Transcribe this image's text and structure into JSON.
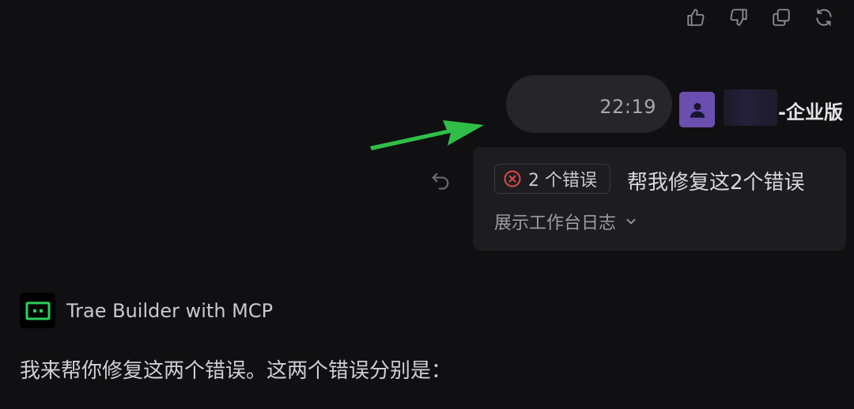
{
  "actions": {
    "like_icon": "thumbs-up-icon",
    "dislike_icon": "thumbs-down-icon",
    "copy_icon": "copy-icon",
    "regenerate_icon": "refresh-icon"
  },
  "user_message": {
    "time": "22:19",
    "user_name": "-企业版",
    "error_chip_label": "2 个错误",
    "text": "帮我修复这2个错误",
    "log_toggle_label": "展示工作台日志"
  },
  "assistant": {
    "name": "Trae Builder with MCP",
    "text": "我来帮你修复这两个错误。这两个错误分别是："
  },
  "colors": {
    "background": "#101012",
    "bubble": "#262629",
    "card": "#1d1d20",
    "avatar": "#6a4fb0",
    "arrow": "#2fbf48",
    "error": "#e0484c",
    "bot_logo_accent": "#2ad15a"
  }
}
